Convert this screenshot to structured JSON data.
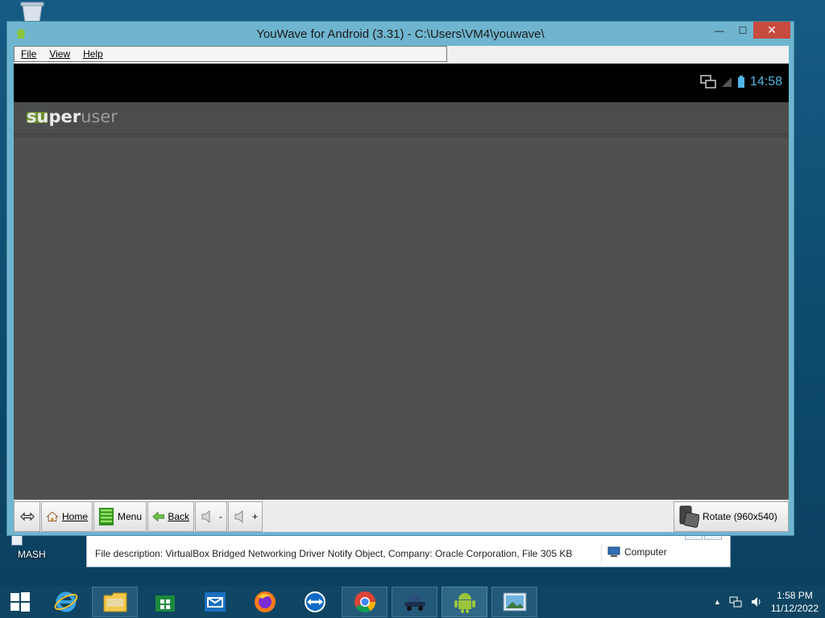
{
  "window": {
    "title": "YouWave for Android (3.31) - C:\\Users\\VM4\\youwave\\",
    "minimize_glyph": "—",
    "maximize_glyph": "☐",
    "close_glyph": "✕"
  },
  "menu": {
    "file": "File",
    "view": "View",
    "help": "Help"
  },
  "android": {
    "clock": "14:58",
    "app_title_bold": "super",
    "app_title_light": "user"
  },
  "controls": {
    "home": "Home",
    "menu": "Menu",
    "back": "Back",
    "vol_down": "-",
    "vol_up": "+",
    "rotate": "Rotate (960x540)"
  },
  "desktop": {
    "icon_label": "MASH"
  },
  "explorer": {
    "description": "File description: VirtualBox Bridged Networking Driver Notify Object, Company: Oracle Corporation, File",
    "size": "305 KB",
    "location": "Computer"
  },
  "taskbar": {
    "time": "1:58 PM",
    "date": "11/12/2022"
  },
  "icons": [
    "recycle-bin-icon",
    "youwave-icon",
    "resize-arrows-icon",
    "home-icon",
    "menu-icon",
    "back-arrow-icon",
    "volume-icon",
    "rotate-device-icon",
    "windows-start-icon",
    "internet-explorer-icon",
    "file-explorer-icon",
    "store-icon",
    "mail-icon",
    "firefox-icon",
    "teamviewer-icon",
    "chrome-icon",
    "vehicle-app-icon",
    "android-icon",
    "photo-viewer-icon"
  ]
}
